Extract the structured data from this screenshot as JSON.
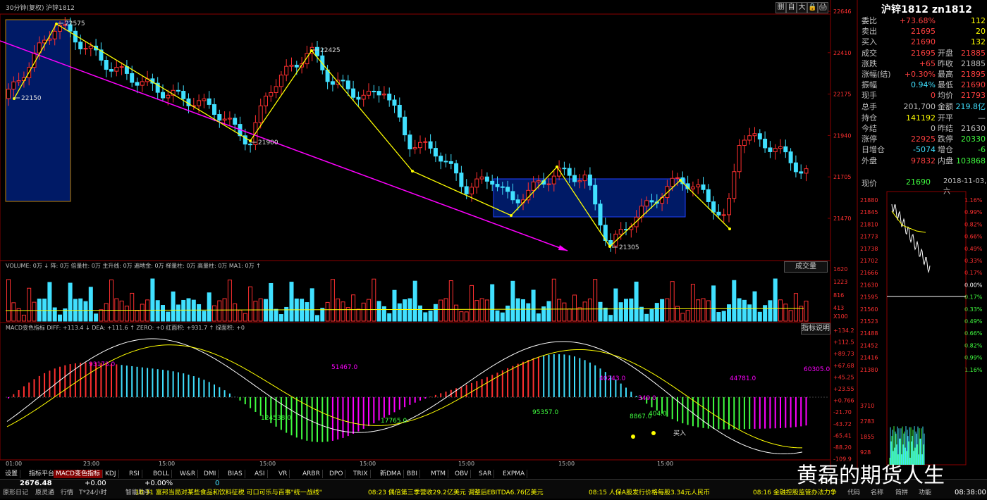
{
  "header": {
    "period": "30分钟(复权)",
    "symbol": "沪锌1812",
    "buttons": [
      "删",
      "自",
      "大",
      "🔒",
      "🖨"
    ]
  },
  "right_panel": {
    "title": "沪锌1812 zn1812",
    "rows": [
      {
        "l": "委比",
        "v": "+73.68%",
        "r": "",
        "rv": "112",
        "vc": "#ff4040",
        "rvc": "#ffff00"
      },
      {
        "l": "卖出",
        "v": "21695",
        "r": "",
        "rv": "20",
        "vc": "#ff4040",
        "rvc": "#ffff00"
      },
      {
        "l": "买入",
        "v": "21690",
        "r": "",
        "rv": "132",
        "vc": "#ff4040",
        "rvc": "#ffff00"
      },
      {
        "l": "成交",
        "v": "21695",
        "r": "开盘",
        "rv": "21885",
        "vc": "#ff4040",
        "rvc": "#ff4040"
      },
      {
        "l": "涨跌",
        "v": "+65",
        "r": "昨收",
        "rv": "21885",
        "vc": "#ff4040",
        "rvc": "#c0c0c0"
      },
      {
        "l": "涨幅(结)",
        "v": "+0.30%",
        "r": "最高",
        "rv": "21895",
        "vc": "#ff4040",
        "rvc": "#ff4040"
      },
      {
        "l": "振幅",
        "v": "0.94%",
        "r": "最低",
        "rv": "21690",
        "vc": "#40e0ff",
        "rvc": "#ff4040"
      },
      {
        "l": "现手",
        "v": "0",
        "r": "均价",
        "rv": "21793",
        "vc": "#ff4040",
        "rvc": "#ff4040"
      },
      {
        "l": "总手",
        "v": "201,700",
        "r": "金额",
        "rv": "219.8亿",
        "vc": "#c0c0c0",
        "rvc": "#40e0ff"
      },
      {
        "l": "持仓",
        "v": "141192",
        "r": "开平",
        "rv": "—",
        "vc": "#ffff00",
        "rvc": "#c0c0c0"
      },
      {
        "l": "今结",
        "v": "0",
        "r": "昨结",
        "rv": "21630",
        "vc": "#c0c0c0",
        "rvc": "#c0c0c0"
      },
      {
        "l": "涨停",
        "v": "22925",
        "r": "跌停",
        "rv": "20330",
        "vc": "#ff4040",
        "rvc": "#40ff40"
      },
      {
        "l": "日增仓",
        "v": "-5074",
        "r": "增仓",
        "rv": "-6",
        "vc": "#40e0ff",
        "rvc": "#40ff40"
      },
      {
        "l": "外盘",
        "v": "97832",
        "r": "内盘",
        "rv": "103868",
        "vc": "#ff4040",
        "rvc": "#40ff40"
      }
    ],
    "now_label": "现价",
    "now_value": "21690",
    "date": "2018-11-03,六",
    "mini_left_ticks": [
      "21880",
      "21845",
      "21810",
      "21773",
      "21738",
      "21702",
      "21666",
      "21630",
      "21595",
      "21560",
      "21523",
      "21488",
      "21452",
      "21416",
      "21380",
      "3710",
      "2783",
      "1855",
      "928"
    ],
    "mini_right_ticks": [
      "1.16%",
      "0.99%",
      "0.82%",
      "0.66%",
      "0.49%",
      "0.33%",
      "0.17%",
      "0.00%",
      "0.17%",
      "0.33%",
      "0.49%",
      "0.66%",
      "0.82%",
      "0.99%",
      "1.16%"
    ]
  },
  "chart": {
    "price_axis": [
      "22646",
      "22410",
      "22175",
      "21940",
      "21705",
      "21470"
    ],
    "annotations": [
      "22575",
      "22150",
      "21900",
      "22425",
      "21305"
    ],
    "vol_title": "VOLUME: 0万 ↓ 阵: 0万 倍量柱: 0万 主升线: 0万 遍地金: 0万 梯量柱: 0万 高量柱: 0万 MA1: 0万 ↑",
    "vol_axis": [
      "1620",
      "1223",
      "816",
      "413",
      "X100"
    ],
    "vol_btn": "成交量",
    "macd_title": "MACD变色指标 DIFF: +113.4 ↓ DEA: +111.6 ↑ ZERO: +0 红面积: +931.7 ↑ 绿面积: +0",
    "macd_btn": "指标说明",
    "macd_axis": [
      "+134.2",
      "+112.5",
      "+89.73",
      "+67.68",
      "+45.25",
      "+23.55",
      "+0.766",
      "-21.70",
      "-43.72",
      "-65.41",
      "-88.20",
      "-109.9"
    ],
    "macd_labels": [
      "93173.0",
      "51467.0",
      "40243.0",
      "44781.0",
      "60305.0",
      "124538.0",
      "17765.0",
      "95357.0",
      "349.0",
      "8867.0",
      "404.0"
    ],
    "buy_label": "买入",
    "time_axis": [
      "01:00",
      "23:00",
      "15:00",
      "15:00",
      "15:00",
      "15:00",
      "15:00",
      "15:00"
    ]
  },
  "tabs": [
    "设置",
    "指标平台",
    "MACD变色指标",
    "KDJ",
    "RSI",
    "BOLL",
    "W&R",
    "DMI",
    "BIAS",
    "ASI",
    "VR",
    "ARBR",
    "DPO",
    "TRIX",
    "新DMA",
    "BBI",
    "MTM",
    "OBV",
    "SAR",
    "EXPMA"
  ],
  "status": {
    "index": "2676.48",
    "change": "+0.00",
    "pct": "+0.00%",
    "zero": "0",
    "items": [
      "原形日记",
      "原灵通",
      "行情",
      "T*24小时",
      "智能助手"
    ],
    "news": [
      {
        "t": "18:31 富邦当局对某些食品和饮料征税 可口可乐与百事\"统一战线\"",
        "c": "#ffff00"
      },
      {
        "t": "08:23 偶倍第三季营收29.2亿美元 调整后EBITDA6.76亿美元",
        "c": "#ffff00"
      },
      {
        "t": "08:15 人保A股发行价格每股3.34元人民币",
        "c": "#ffff00"
      },
      {
        "t": "08:16 金融控股监管办法力争",
        "c": "#ffff00"
      }
    ],
    "right_items": [
      "代码",
      "名称",
      "简拼",
      "功能"
    ],
    "clock": "08:38:00",
    "watermark": "黄磊的期货人生"
  },
  "colors": {
    "up": "#ff3030",
    "down": "#40e0ff",
    "ma": "#ffff00",
    "trend": "#ff00ff",
    "box": "#001a66"
  }
}
